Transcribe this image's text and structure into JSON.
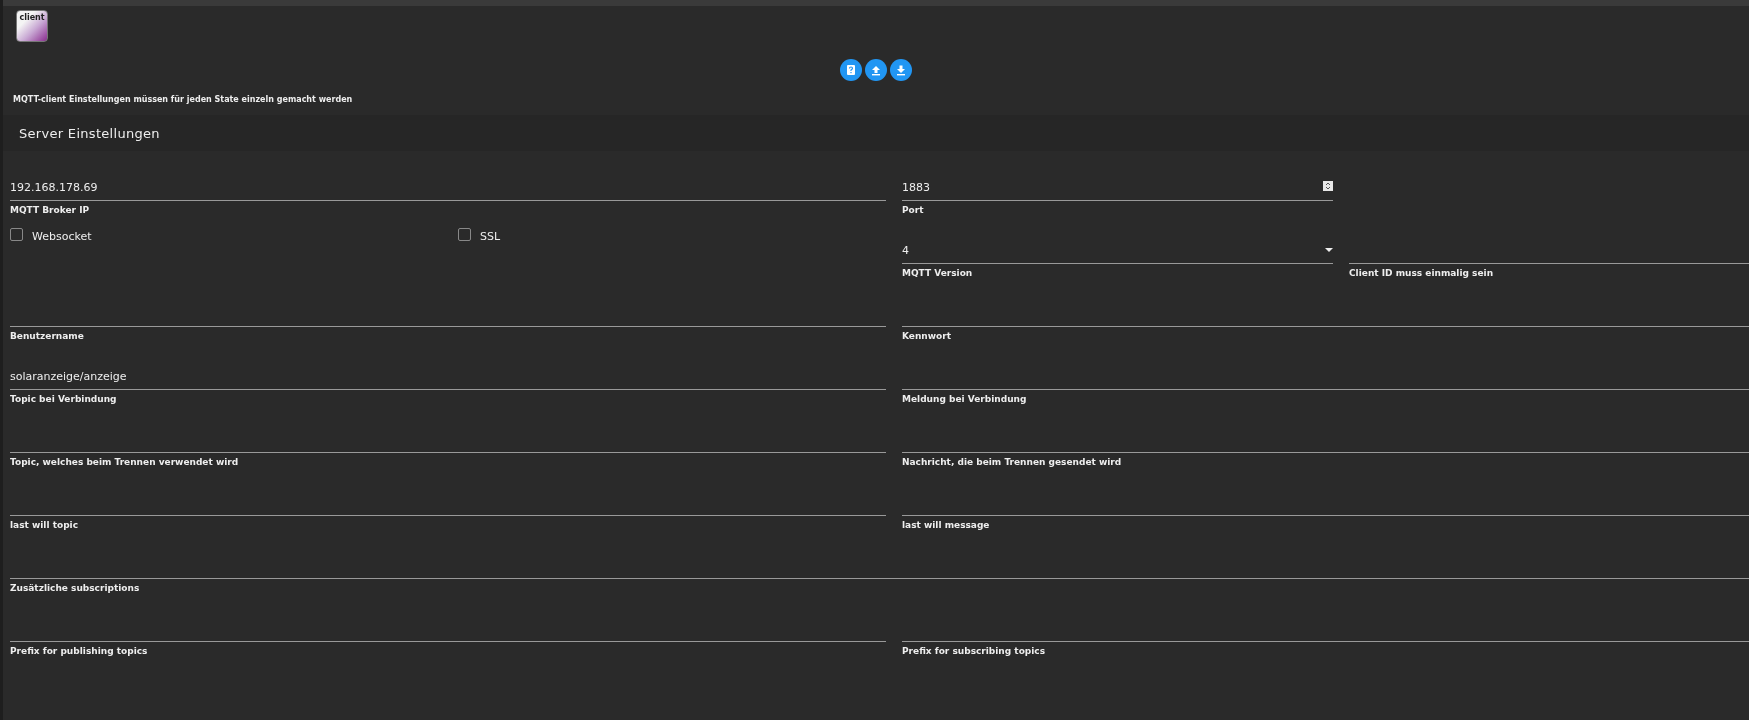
{
  "header": {
    "logo_text": "client"
  },
  "toolbar": {
    "buttons": [
      {
        "kind": "help"
      },
      {
        "kind": "upload"
      },
      {
        "kind": "download"
      }
    ]
  },
  "note": "MQTT-client Einstellungen müssen für jeden State einzeln gemacht werden",
  "section": {
    "title": "Server Einstellungen"
  },
  "rows": [
    [
      {
        "kind": "text",
        "label": "MQTT Broker IP",
        "value": "192.168.178.69"
      },
      {
        "kind": "number",
        "label": "Port",
        "value": "1883"
      }
    ],
    [
      {
        "kind": "checkbox",
        "label": "Websocket",
        "checked": false
      },
      {
        "kind": "checkbox",
        "label": "SSL",
        "checked": false
      },
      {
        "kind": "select",
        "label": "MQTT Version",
        "value": "4"
      },
      {
        "kind": "text",
        "label": "Client ID muss einmalig sein"
      }
    ],
    [
      {
        "kind": "text",
        "label": "Benutzername"
      },
      {
        "kind": "text",
        "label": "Kennwort"
      }
    ],
    [
      {
        "kind": "text",
        "label": "Topic bei Verbindung",
        "value": "solaranzeige/anzeige"
      },
      {
        "kind": "text",
        "label": "Meldung bei Verbindung"
      }
    ],
    [
      {
        "kind": "text",
        "label": "Topic, welches beim Trennen verwendet wird"
      },
      {
        "kind": "text",
        "label": "Nachricht, die beim Trennen gesendet wird"
      }
    ],
    [
      {
        "kind": "text",
        "label": "last will topic"
      },
      {
        "kind": "text",
        "label": "last will message"
      }
    ],
    [
      {
        "kind": "text",
        "label": "Zusätzliche subscriptions"
      }
    ],
    [
      {
        "kind": "text",
        "label": "Prefix for publishing topics"
      },
      {
        "kind": "text",
        "label": "Prefix for subscribing topics"
      }
    ]
  ]
}
